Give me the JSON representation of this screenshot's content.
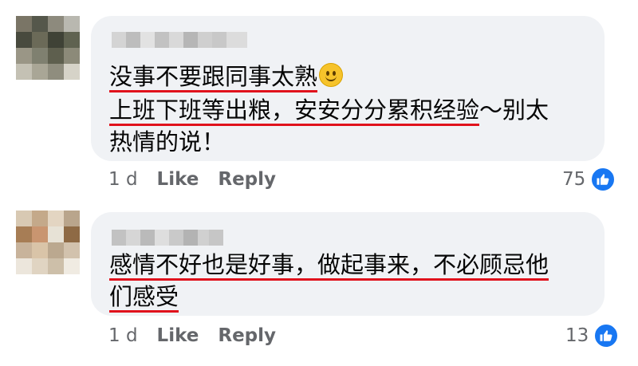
{
  "comments": [
    {
      "lines": [
        {
          "segments": [
            {
              "text": "没事不要跟同事太熟",
              "underline": true
            }
          ],
          "emoji": "smile-icon"
        },
        {
          "segments": [
            {
              "text": "上班下班等出粮，安安分分累积经验",
              "underline": true
            },
            {
              "text": "～别太",
              "underline": false
            }
          ]
        },
        {
          "segments": [
            {
              "text": "热情的说！",
              "underline": false
            }
          ]
        }
      ],
      "age": "1 d",
      "like_label": "Like",
      "reply_label": "Reply",
      "reaction_count": "75"
    },
    {
      "lines": [
        {
          "segments": [
            {
              "text": "感情不好也是好事，做起事来，不必顾忌他",
              "underline": true
            }
          ]
        },
        {
          "segments": [
            {
              "text": "们感受",
              "underline": true
            }
          ]
        }
      ],
      "age": "1 d",
      "like_label": "Like",
      "reply_label": "Reply",
      "reaction_count": "13"
    }
  ],
  "colors": {
    "bubble": "#f0f2f5",
    "underline": "#e0121c",
    "like_blue": "#1877f2",
    "meta_grey": "#65676b"
  }
}
